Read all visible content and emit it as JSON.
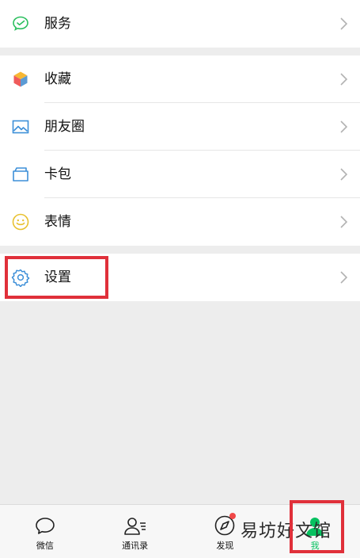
{
  "menu": {
    "services": {
      "label": "服务",
      "icon": "wechat-pay-icon"
    },
    "favorites": {
      "label": "收藏",
      "icon": "cube-icon"
    },
    "moments": {
      "label": "朋友圈",
      "icon": "picture-icon"
    },
    "cards": {
      "label": "卡包",
      "icon": "wallet-icon"
    },
    "stickers": {
      "label": "表情",
      "icon": "smiley-icon"
    },
    "settings": {
      "label": "设置",
      "icon": "gear-icon"
    }
  },
  "tabbar": {
    "tabs": [
      {
        "label": "微信",
        "icon": "chat-bubble-icon",
        "active": false
      },
      {
        "label": "通讯录",
        "icon": "contacts-icon",
        "active": false
      },
      {
        "label": "发现",
        "icon": "compass-icon",
        "active": false,
        "badge_dot": true
      },
      {
        "label": "我",
        "icon": "person-icon",
        "active": true
      }
    ]
  },
  "watermark": "易坊好文馆",
  "colors": {
    "accent": "#07c160",
    "highlight": "#e0303a",
    "badge": "#f04848"
  }
}
